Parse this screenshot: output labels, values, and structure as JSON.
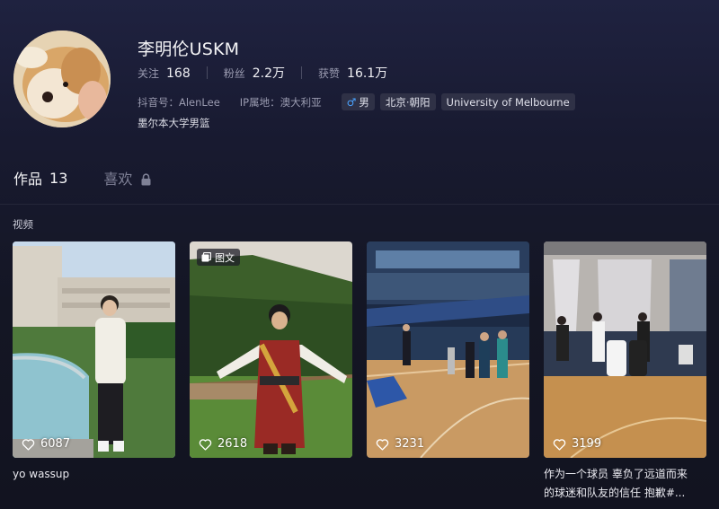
{
  "profile": {
    "name": "李明伦USKM",
    "stats": [
      {
        "label": "关注",
        "value": "168"
      },
      {
        "label": "粉丝",
        "value": "2.2万"
      },
      {
        "label": "获赞",
        "value": "16.1万"
      }
    ],
    "douyin_id": "抖音号：AlenLee",
    "ip_location": "IP属地：澳大利亚",
    "tags": [
      "男",
      "北京·朝阳",
      "University of Melbourne"
    ],
    "bio": "墨尔本大学男篮"
  },
  "tabs": [
    {
      "label": "作品",
      "count": "13"
    },
    {
      "label": "喜欢"
    }
  ],
  "section_label": "视频",
  "videos": [
    {
      "likes": "6087",
      "caption": "yo wassup"
    },
    {
      "likes": "2618",
      "badge": "图文",
      "caption": ""
    },
    {
      "likes": "3231",
      "caption": ""
    },
    {
      "likes": "3199",
      "caption_line1": "作为一个球员 辜负了远道而来",
      "caption_line2": "的球迷和队友的信任 抱歉#..."
    }
  ]
}
